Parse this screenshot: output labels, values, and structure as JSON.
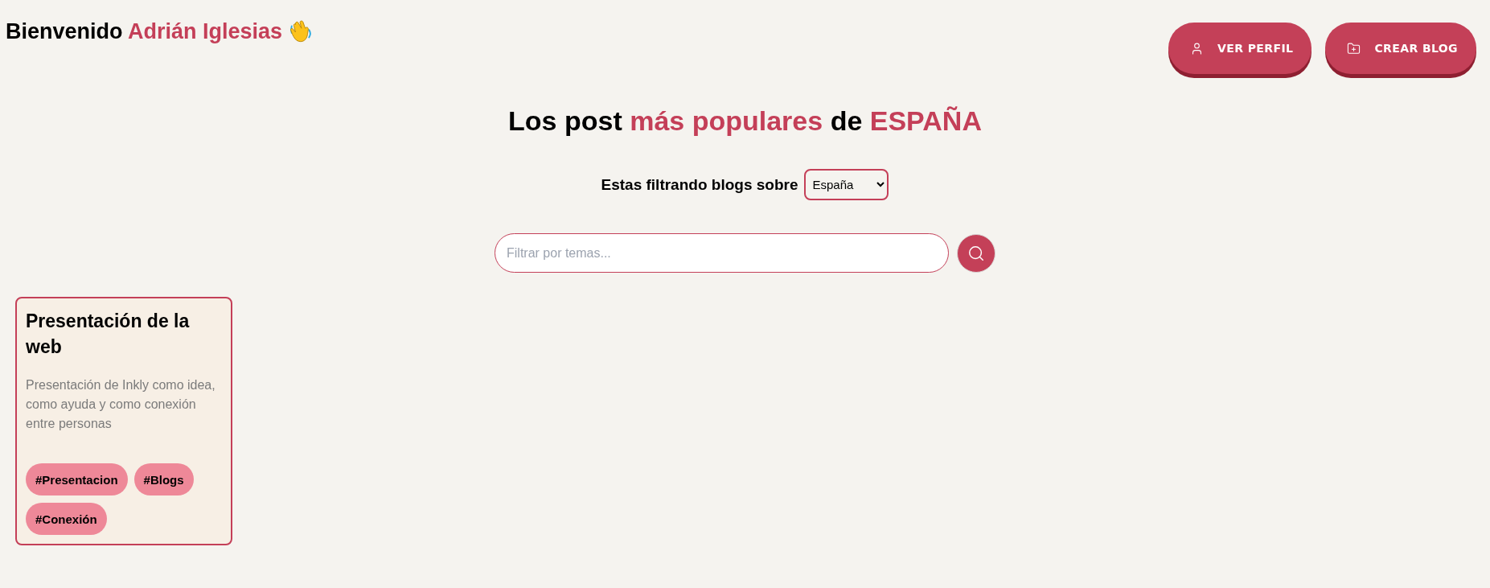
{
  "header": {
    "greeting": "Bienvenido",
    "user_name": "Adrián Iglesias"
  },
  "actions": [
    {
      "kind": "profile",
      "label": "VER PERFIL"
    },
    {
      "kind": "create",
      "label": "CREAR BLOG"
    }
  ],
  "title": {
    "lead": "Los post",
    "highlight": "más populares",
    "middle": "de",
    "country": "ESPAÑA"
  },
  "filter": {
    "label": "Estas filtrando blogs sobre",
    "value": "España"
  },
  "search": {
    "placeholder": "Filtrar por temas..."
  },
  "posts": [
    {
      "title": "Presentación de la web",
      "description": "Presentación de Inkly como idea, como ayuda y como conexión entre personas",
      "tags": [
        "#Presentacion",
        "#Blogs",
        "#Conexión"
      ]
    }
  ]
}
